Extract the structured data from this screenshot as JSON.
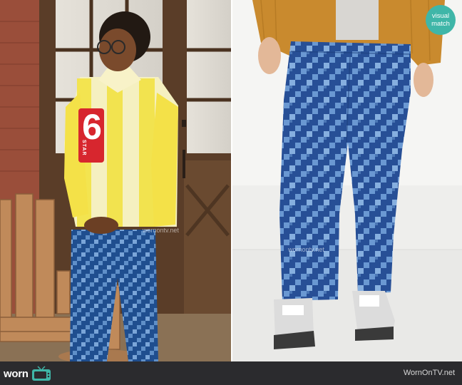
{
  "left_photo": {
    "shirt_number": "6",
    "shirt_patch_text": "STAR",
    "watermark": "wornontv.net"
  },
  "right_photo": {
    "watermark": "wornontv.net"
  },
  "badge": {
    "line1": "visual",
    "line2": "match",
    "color": "#3fb6a8"
  },
  "footer": {
    "logo_text": "worn",
    "logo_icon": "tv-icon",
    "site": "WornOnTV.net",
    "background": "#2b2b2e"
  }
}
